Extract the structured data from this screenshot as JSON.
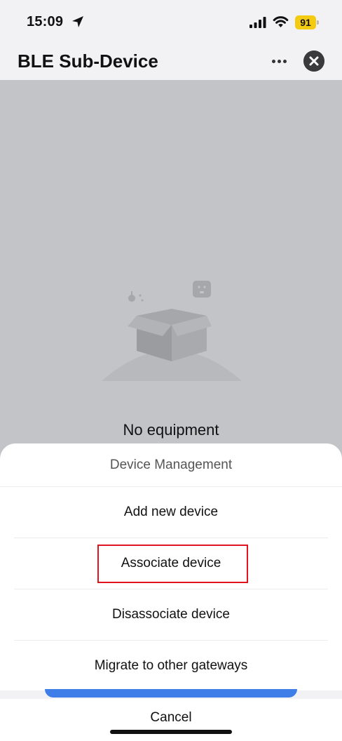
{
  "status_bar": {
    "time": "15:09",
    "battery": "91"
  },
  "header": {
    "title": "BLE Sub-Device"
  },
  "icons": {
    "location": "location-arrow-icon",
    "signal": "cellular-signal-icon",
    "wifi": "wifi-icon",
    "more": "more-dots-icon",
    "close": "close-icon",
    "empty": "empty-box-illustration"
  },
  "main": {
    "empty_text": "No equipment"
  },
  "sheet": {
    "title": "Device Management",
    "options": [
      {
        "label": "Add new device"
      },
      {
        "label": "Associate device"
      },
      {
        "label": "Disassociate device"
      },
      {
        "label": "Migrate to other gateways"
      }
    ],
    "cancel_label": "Cancel"
  },
  "colors": {
    "overlay": "#c3c4c8",
    "highlight": "#e0141e",
    "battery": "#f5cb11",
    "primary": "#3f7ee8"
  }
}
